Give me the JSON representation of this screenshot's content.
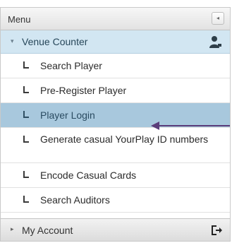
{
  "menu": {
    "title": "Menu",
    "collapse_icon": "◂"
  },
  "venue": {
    "arrow_icon": "▾",
    "label": "Venue Counter",
    "icon": "user-icon"
  },
  "items": [
    {
      "label": "Search Player"
    },
    {
      "label": "Pre-Register Player"
    },
    {
      "label": "Player Login",
      "selected": true
    },
    {
      "label": "Generate casual YourPlay ID numbers"
    },
    {
      "label": "Encode Casual Cards"
    },
    {
      "label": "Search Auditors"
    }
  ],
  "account": {
    "arrow_icon": "▸",
    "label": "My Account",
    "icon": "logout-icon"
  },
  "colors": {
    "selected_bg": "#a8c8dd",
    "venue_bg": "#d2e6f2",
    "annotation_arrow": "#5b3d7a"
  }
}
